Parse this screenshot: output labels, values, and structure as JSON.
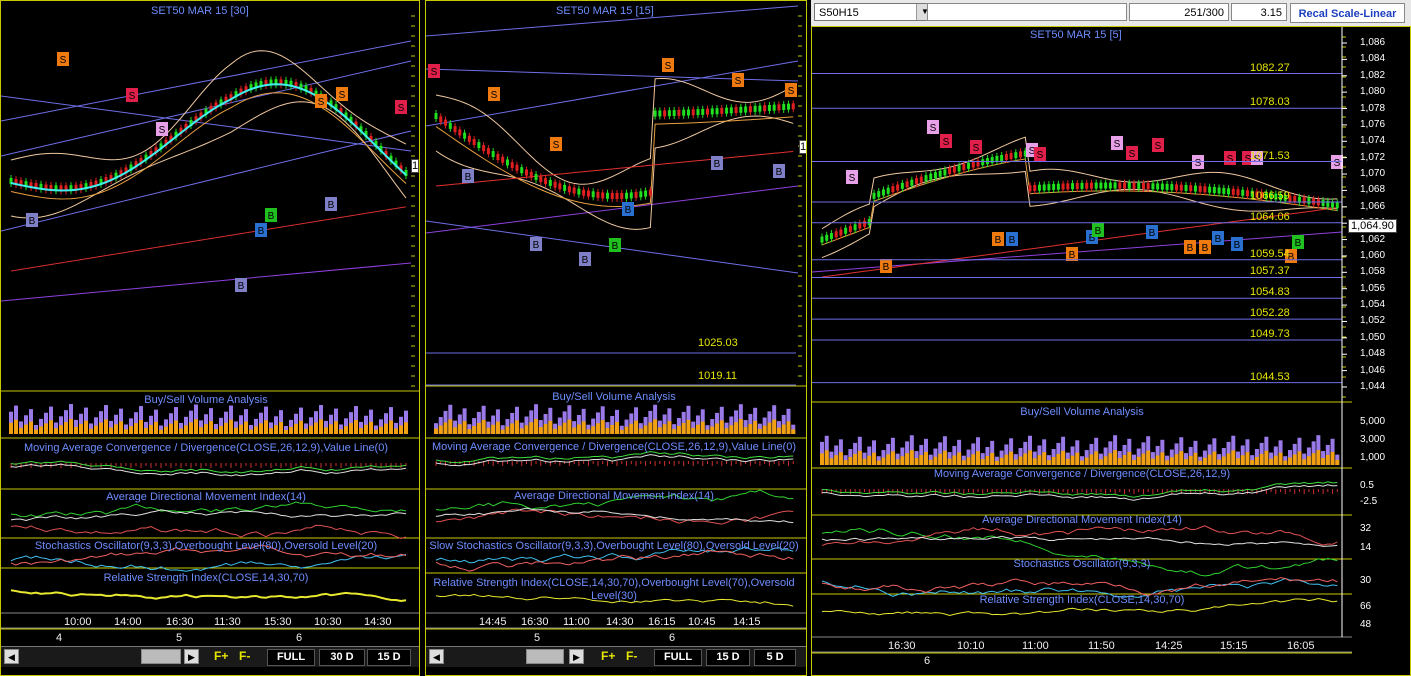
{
  "panes": [
    {
      "title": "SET50 MAR 15   [30]",
      "indicators": {
        "volume": "Buy/Sell Volume Analysis",
        "macd": "Moving Average Convergence / Divergence(CLOSE,26,12,9),Value Line(0)",
        "adx": "Average Directional Movement Index(14)",
        "stoch": "Stochastics Oscillator(9,3,3),Overbought Level(80),Oversold Level(20)",
        "rsi": "Relative Strength Index(CLOSE,14,30,70)"
      },
      "time_labels": [
        "10:00",
        "14:00",
        "16:30",
        "11:30",
        "15:30",
        "10:30",
        "14:30"
      ],
      "day_labels": [
        "4",
        "5",
        "6"
      ],
      "buttons": [
        "FULL",
        "30 D",
        "15 D"
      ],
      "edge_label": "1"
    },
    {
      "title": "SET50 MAR 15   [15]",
      "levels": [
        "1025.03",
        "1019.11"
      ],
      "indicators": {
        "volume": "Buy/Sell Volume Analysis",
        "macd": "Moving Average Convergence / Divergence(CLOSE,26,12,9),Value Line(0)",
        "adx": "Average Directional Movement Index(14)",
        "stoch": "Slow Stochastics Oscillator(9,3,3),Overbought Level(80),Oversold Level(20)",
        "rsi": "Relative Strength Index(CLOSE,14,30,70),Overbought Level(70),Oversold Level(30)"
      },
      "time_labels": [
        "14:45",
        "16:30",
        "11:00",
        "14:30",
        "16:15",
        "10:45",
        "14:15"
      ],
      "day_labels": [
        "5",
        "6"
      ],
      "buttons": [
        "FULL",
        "15 D",
        "5 D"
      ],
      "edge_label": "1"
    },
    {
      "title": "SET50 MAR 15   [5]",
      "levels": [
        "1082.27",
        "1078.03",
        "1071.53",
        "1066.59",
        "1064.06",
        "1059.54",
        "1057.37",
        "1054.83",
        "1052.28",
        "1049.73",
        "1044.53"
      ],
      "price_tag": "1,064.90",
      "axis_labels": [
        "1,086",
        "1,084",
        "1,082",
        "1,080",
        "1,078",
        "1,076",
        "1,074",
        "1,072",
        "1,070",
        "1,068",
        "1,066",
        "1,064",
        "1,062",
        "1,060",
        "1,058",
        "1,056",
        "1,054",
        "1,052",
        "1,050",
        "1,048",
        "1,046",
        "1,044"
      ],
      "vol_axis": [
        "5,000",
        "3,000",
        "1,000"
      ],
      "macd_axis": [
        "0.5",
        "-2.5"
      ],
      "adx_axis": [
        "32",
        "14"
      ],
      "stoch_axis": [
        "30"
      ],
      "rsi_axis": [
        "66",
        "48"
      ],
      "indicators": {
        "volume": "Buy/Sell Volume Analysis",
        "macd": "Moving Average Convergence / Divergence(CLOSE,26,12,9)",
        "adx": "Average Directional Movement Index(14)",
        "stoch": "Stochastics Oscillator(9,3,3)",
        "rsi": "Relative Strength Index(CLOSE,14,30,70)"
      },
      "time_labels": [
        "16:30",
        "10:10",
        "11:00",
        "11:50",
        "14:25",
        "15:15",
        "16:05"
      ],
      "day_labels": [
        "6"
      ]
    }
  ],
  "toolbar": {
    "symbol": "S50H15",
    "counter": "251/300",
    "value": "3.15",
    "recal": "Recal Scale-Linear"
  },
  "f_buttons": [
    "F+",
    "F-"
  ],
  "colors": {
    "buy_signal": "#4a70d8",
    "sell_signal": "#ee7a10",
    "level": "#e6e600",
    "title": "#6d8dff"
  }
}
